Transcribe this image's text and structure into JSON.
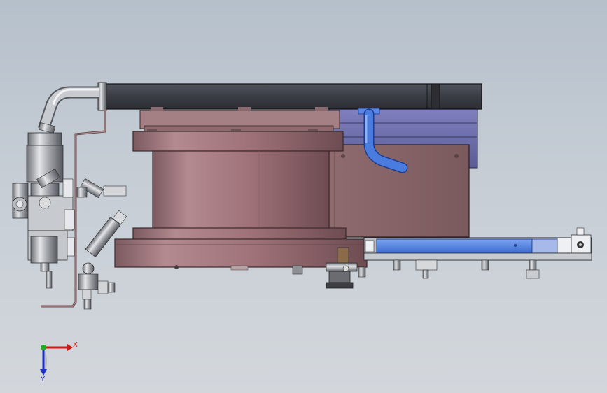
{
  "view": {
    "background_top": "#b6c0cb",
    "background_bottom": "#d3d7dc"
  },
  "triad": {
    "x_label": "X",
    "y_label": "Y",
    "x_color": "#d01818",
    "y_color": "#2030c0",
    "origin_color": "#22aa22"
  },
  "parts": {
    "top_plate_color": "#3a3d44",
    "housing_color": "#9a7278",
    "bracket_color": "#8a6a6c",
    "blue_cover_color": "#6d6fae",
    "blue_rail_color": "#4f7fe0",
    "tube_color": "#3b6fd8",
    "steel_color": "#a7aab0"
  }
}
